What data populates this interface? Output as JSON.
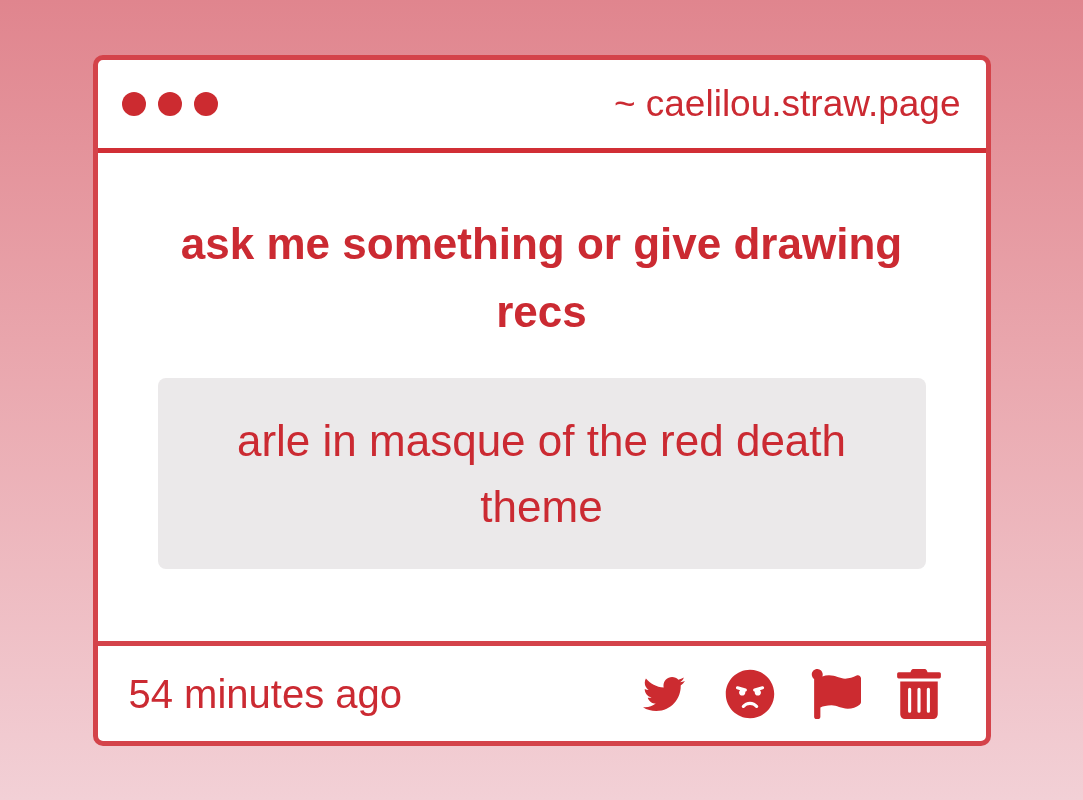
{
  "header": {
    "url": "~ caelilou.straw.page"
  },
  "prompt": {
    "title": "ask me something or give drawing recs",
    "question": "arle in masque of the red death theme"
  },
  "footer": {
    "time": "54 minutes ago"
  }
}
